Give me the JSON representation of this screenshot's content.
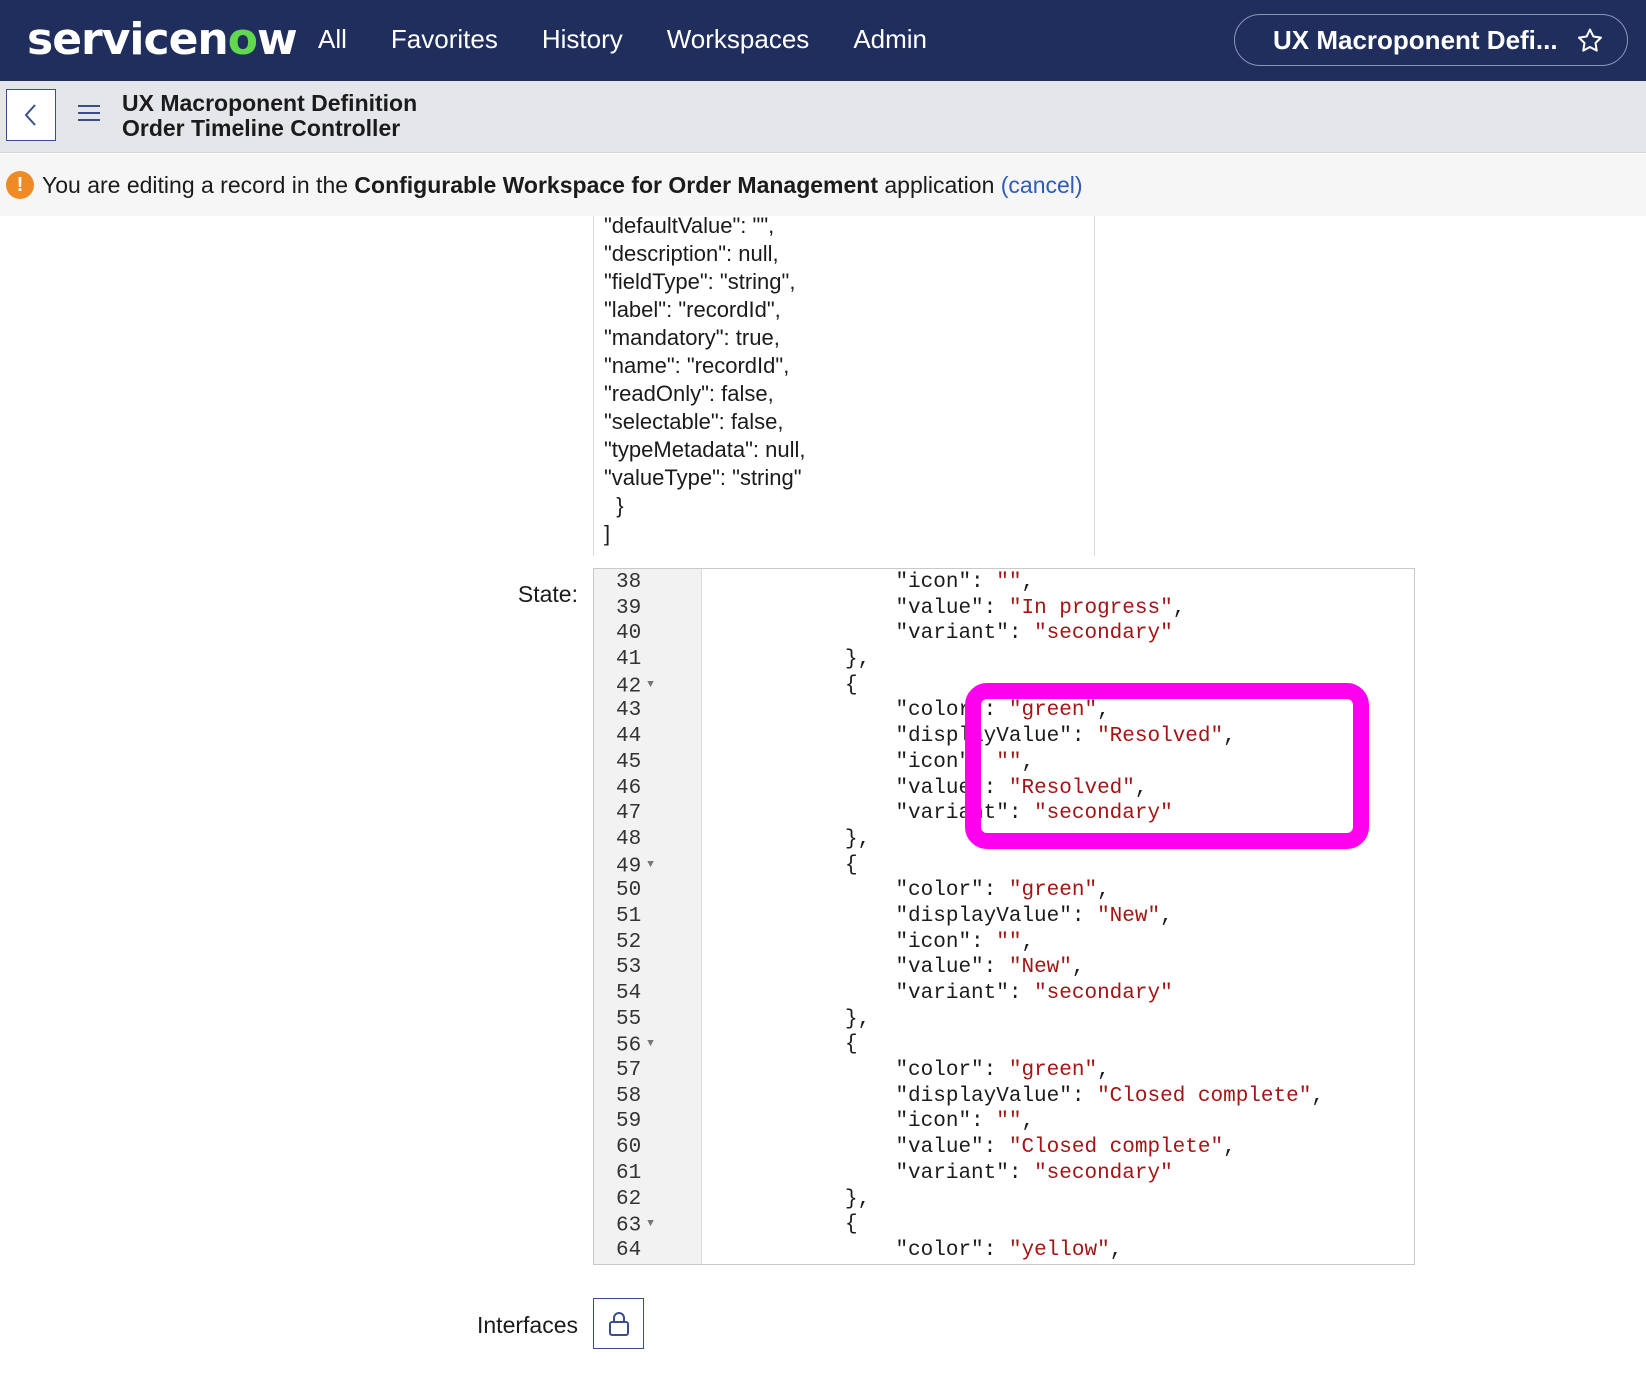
{
  "nav": {
    "logo_prefix": "servicen",
    "logo_o": "o",
    "logo_suffix": "w",
    "items": [
      "All",
      "Favorites",
      "History",
      "Workspaces",
      "Admin"
    ],
    "context_title": "UX Macroponent Defi...",
    "star_icon": "star-icon"
  },
  "record": {
    "type": "UX Macroponent Definition",
    "name": "Order Timeline Controller"
  },
  "notice": {
    "prefix": "You are editing a record in the ",
    "app_name": "Configurable Workspace for Order Management",
    "suffix": " application ",
    "cancel": "(cancel)"
  },
  "upper_json": "\"defaultValue\": \"\",\n\"description\": null,\n\"fieldType\": \"string\",\n\"label\": \"recordId\",\n\"mandatory\": true,\n\"name\": \"recordId\",\n\"readOnly\": false,\n\"selectable\": false,\n\"typeMetadata\": null,\n\"valueType\": \"string\"\n  }\n]",
  "labels": {
    "state": "State:",
    "interfaces": "Interfaces"
  },
  "editor_lines": [
    {
      "n": "38",
      "fold": false,
      "indent": "        ",
      "parts": [
        [
          "k",
          "\"icon\": "
        ],
        [
          "s",
          "\"\""
        ],
        [
          "k",
          ","
        ]
      ]
    },
    {
      "n": "39",
      "fold": false,
      "indent": "        ",
      "parts": [
        [
          "k",
          "\"value\": "
        ],
        [
          "s",
          "\"In progress\""
        ],
        [
          "k",
          ","
        ]
      ]
    },
    {
      "n": "40",
      "fold": false,
      "indent": "        ",
      "parts": [
        [
          "k",
          "\"variant\": "
        ],
        [
          "s",
          "\"secondary\""
        ]
      ]
    },
    {
      "n": "41",
      "fold": false,
      "indent": "    ",
      "parts": [
        [
          "k",
          "},"
        ]
      ]
    },
    {
      "n": "42",
      "fold": true,
      "indent": "    ",
      "parts": [
        [
          "k",
          "{"
        ]
      ]
    },
    {
      "n": "43",
      "fold": false,
      "indent": "        ",
      "parts": [
        [
          "k",
          "\"color\": "
        ],
        [
          "s",
          "\"green\""
        ],
        [
          "k",
          ","
        ]
      ]
    },
    {
      "n": "44",
      "fold": false,
      "indent": "        ",
      "parts": [
        [
          "k",
          "\"displayValue\": "
        ],
        [
          "s",
          "\"Resolved\""
        ],
        [
          "k",
          ","
        ]
      ]
    },
    {
      "n": "45",
      "fold": false,
      "indent": "        ",
      "parts": [
        [
          "k",
          "\"icon\": "
        ],
        [
          "s",
          "\"\""
        ],
        [
          "k",
          ","
        ]
      ]
    },
    {
      "n": "46",
      "fold": false,
      "indent": "        ",
      "parts": [
        [
          "k",
          "\"value\": "
        ],
        [
          "s",
          "\"Resolved\""
        ],
        [
          "k",
          ","
        ]
      ]
    },
    {
      "n": "47",
      "fold": false,
      "indent": "        ",
      "parts": [
        [
          "k",
          "\"variant\": "
        ],
        [
          "s",
          "\"secondary\""
        ]
      ]
    },
    {
      "n": "48",
      "fold": false,
      "indent": "    ",
      "parts": [
        [
          "k",
          "},"
        ]
      ]
    },
    {
      "n": "49",
      "fold": true,
      "indent": "    ",
      "parts": [
        [
          "k",
          "{"
        ]
      ]
    },
    {
      "n": "50",
      "fold": false,
      "indent": "        ",
      "parts": [
        [
          "k",
          "\"color\": "
        ],
        [
          "s",
          "\"green\""
        ],
        [
          "k",
          ","
        ]
      ]
    },
    {
      "n": "51",
      "fold": false,
      "indent": "        ",
      "parts": [
        [
          "k",
          "\"displayValue\": "
        ],
        [
          "s",
          "\"New\""
        ],
        [
          "k",
          ","
        ]
      ]
    },
    {
      "n": "52",
      "fold": false,
      "indent": "        ",
      "parts": [
        [
          "k",
          "\"icon\": "
        ],
        [
          "s",
          "\"\""
        ],
        [
          "k",
          ","
        ]
      ]
    },
    {
      "n": "53",
      "fold": false,
      "indent": "        ",
      "parts": [
        [
          "k",
          "\"value\": "
        ],
        [
          "s",
          "\"New\""
        ],
        [
          "k",
          ","
        ]
      ]
    },
    {
      "n": "54",
      "fold": false,
      "indent": "        ",
      "parts": [
        [
          "k",
          "\"variant\": "
        ],
        [
          "s",
          "\"secondary\""
        ]
      ]
    },
    {
      "n": "55",
      "fold": false,
      "indent": "    ",
      "parts": [
        [
          "k",
          "},"
        ]
      ]
    },
    {
      "n": "56",
      "fold": true,
      "indent": "    ",
      "parts": [
        [
          "k",
          "{"
        ]
      ]
    },
    {
      "n": "57",
      "fold": false,
      "indent": "        ",
      "parts": [
        [
          "k",
          "\"color\": "
        ],
        [
          "s",
          "\"green\""
        ],
        [
          "k",
          ","
        ]
      ]
    },
    {
      "n": "58",
      "fold": false,
      "indent": "        ",
      "parts": [
        [
          "k",
          "\"displayValue\": "
        ],
        [
          "s",
          "\"Closed complete\""
        ],
        [
          "k",
          ","
        ]
      ]
    },
    {
      "n": "59",
      "fold": false,
      "indent": "        ",
      "parts": [
        [
          "k",
          "\"icon\": "
        ],
        [
          "s",
          "\"\""
        ],
        [
          "k",
          ","
        ]
      ]
    },
    {
      "n": "60",
      "fold": false,
      "indent": "        ",
      "parts": [
        [
          "k",
          "\"value\": "
        ],
        [
          "s",
          "\"Closed complete\""
        ],
        [
          "k",
          ","
        ]
      ]
    },
    {
      "n": "61",
      "fold": false,
      "indent": "        ",
      "parts": [
        [
          "k",
          "\"variant\": "
        ],
        [
          "s",
          "\"secondary\""
        ]
      ]
    },
    {
      "n": "62",
      "fold": false,
      "indent": "    ",
      "parts": [
        [
          "k",
          "},"
        ]
      ]
    },
    {
      "n": "63",
      "fold": true,
      "indent": "    ",
      "parts": [
        [
          "k",
          "{"
        ]
      ]
    },
    {
      "n": "64",
      "fold": false,
      "indent": "        ",
      "parts": [
        [
          "k",
          "\"color\": "
        ],
        [
          "s",
          "\"yellow\""
        ],
        [
          "k",
          ","
        ]
      ]
    }
  ],
  "colors": {
    "nav_bg": "#1f2e5c",
    "logo_accent": "#62d84e",
    "highlight": "#ff00ee",
    "string": "#a31515",
    "warning": "#f08a24",
    "link": "#2e5ab8"
  },
  "icons": {
    "back": "chevron-left-icon",
    "menu": "hamburger-menu-icon",
    "warning": "warning-icon",
    "lock": "lock-icon"
  }
}
